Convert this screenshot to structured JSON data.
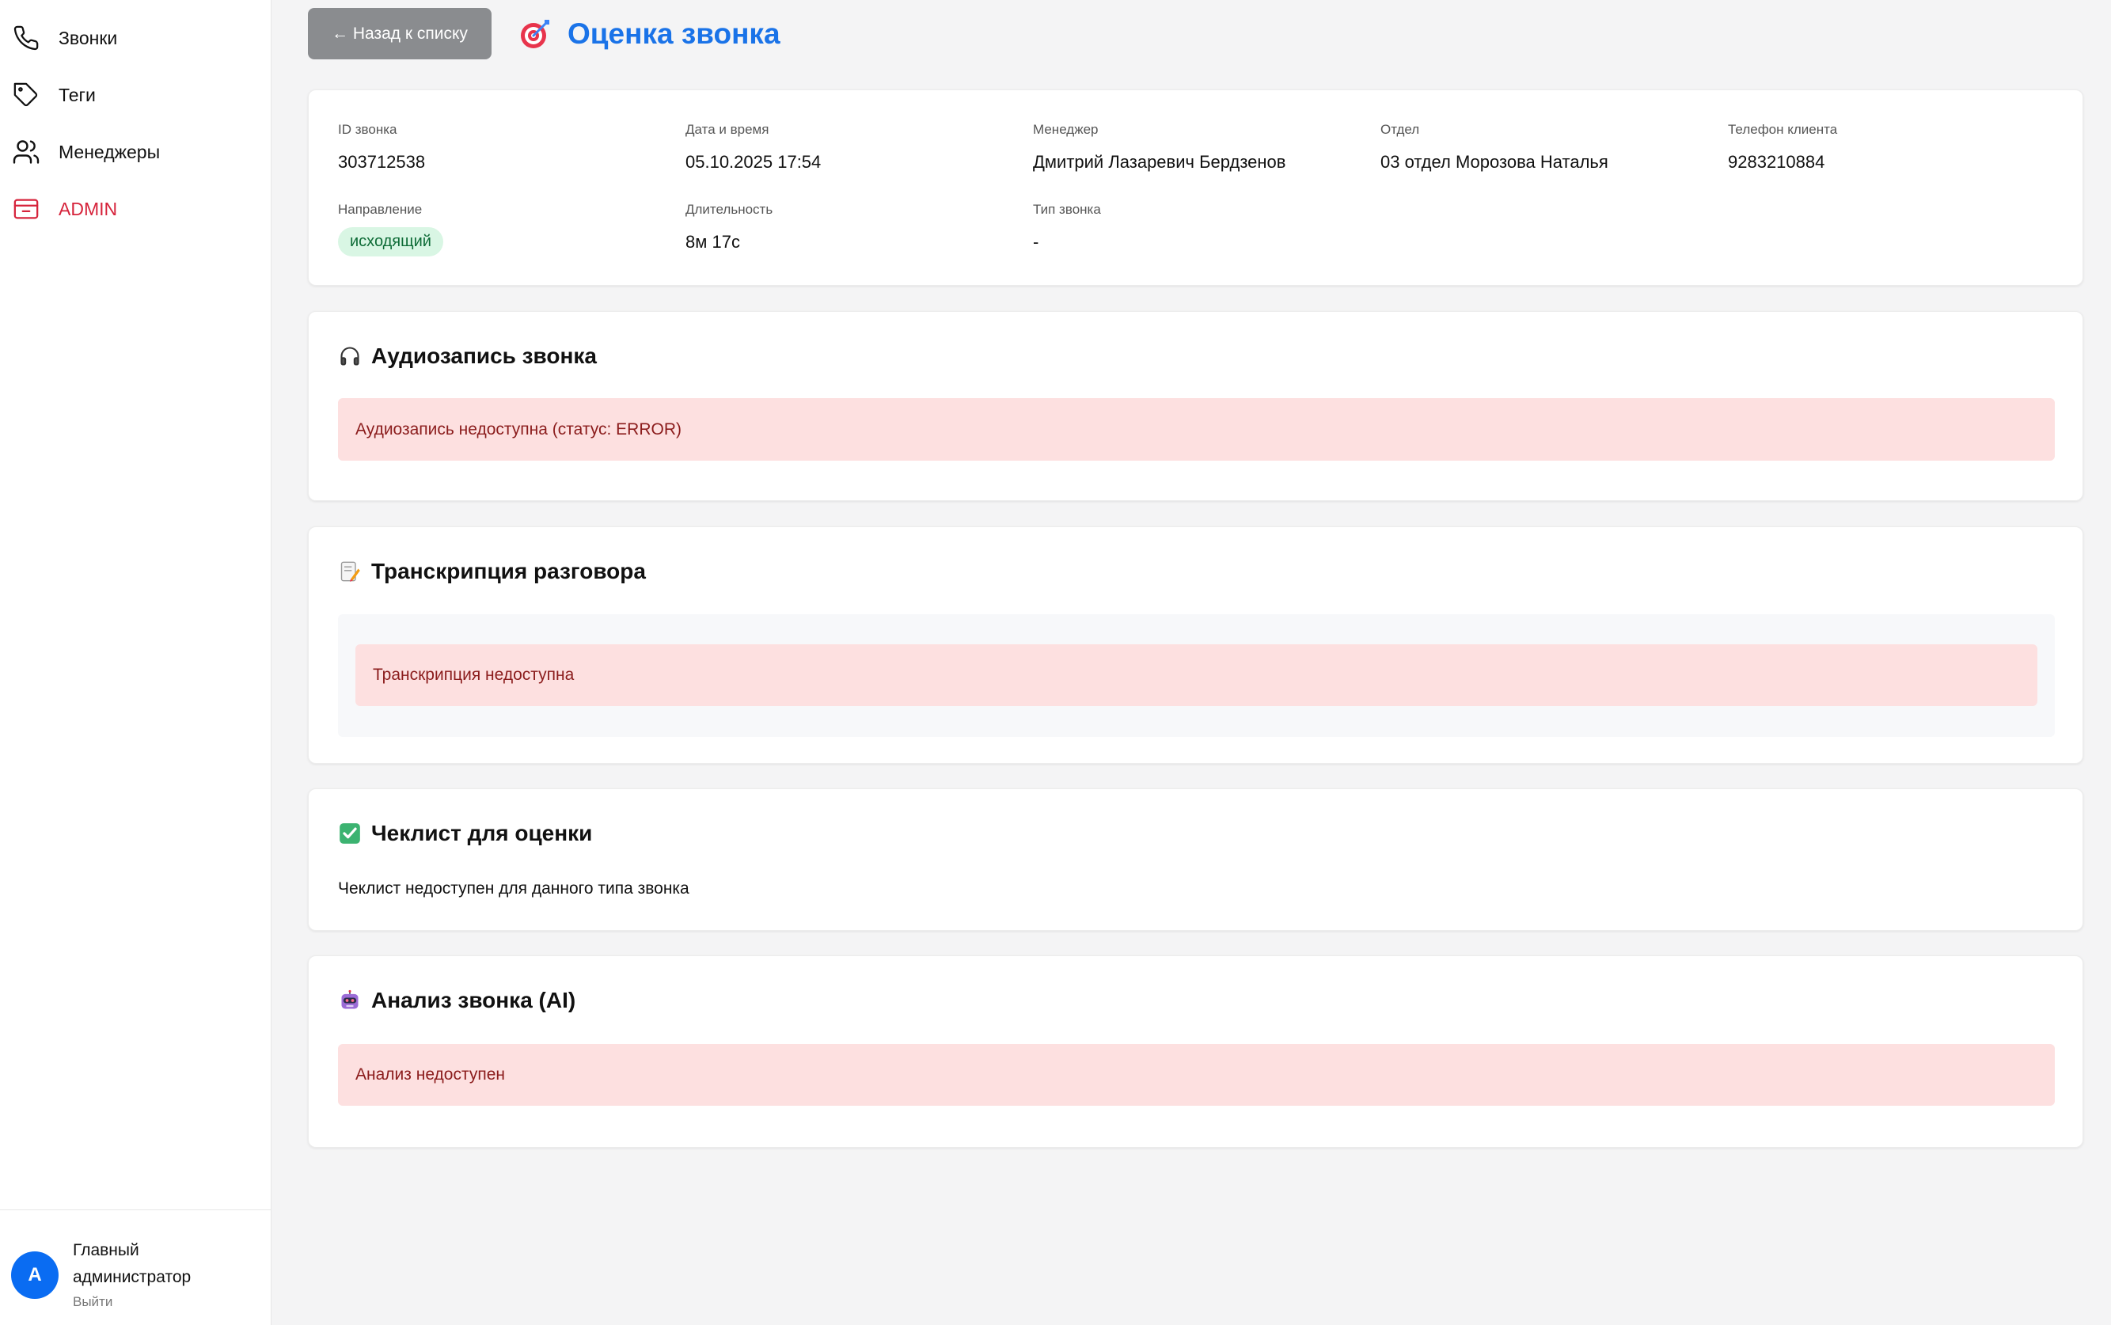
{
  "sidebar": {
    "items": [
      {
        "label": "Звонки",
        "icon": "phone-icon"
      },
      {
        "label": "Теги",
        "icon": "tag-icon"
      },
      {
        "label": "Менеджеры",
        "icon": "users-icon"
      },
      {
        "label": "ADMIN",
        "icon": "admin-panel-icon"
      }
    ],
    "user": {
      "avatar_letter": "A",
      "name": "Главный администратор",
      "logout": "Выйти"
    }
  },
  "header": {
    "back_label": "← Назад к списку",
    "title": "Оценка звонка",
    "title_icon": "target-icon"
  },
  "call_info": {
    "id_label": "ID звонка",
    "id_value": "303712538",
    "datetime_label": "Дата и время",
    "datetime_value": "05.10.2025 17:54",
    "manager_label": "Менеджер",
    "manager_value": "Дмитрий Лазаревич Бердзенов",
    "department_label": "Отдел",
    "department_value": "03 отдел Морозова Наталья",
    "phone_label": "Телефон клиента",
    "phone_value": "9283210884",
    "direction_label": "Направление",
    "direction_value": "исходящий",
    "duration_label": "Длительность",
    "duration_value": "8м 17с",
    "type_label": "Тип звонка",
    "type_value": "-"
  },
  "audio": {
    "title": "Аудиозапись звонка",
    "icon": "headphones-icon",
    "message": "Аудиозапись недоступна (статус: ERROR)"
  },
  "transcript": {
    "title": "Транскрипция разговора",
    "icon": "memo-icon",
    "message": "Транскрипция недоступна"
  },
  "checklist": {
    "title": "Чеклист для оценки",
    "icon": "check-box-icon",
    "message": "Чеклист недоступен для данного типа звонка"
  },
  "analysis": {
    "title": "Анализ звонка (AI)",
    "icon": "robot-icon",
    "message": "Анализ недоступен"
  },
  "colors": {
    "accent": "#1a73e8",
    "admin": "#d6233b",
    "error_bg": "#fde0e0",
    "error_text": "#8b1c1c",
    "badge_bg": "#d9f6e4"
  }
}
